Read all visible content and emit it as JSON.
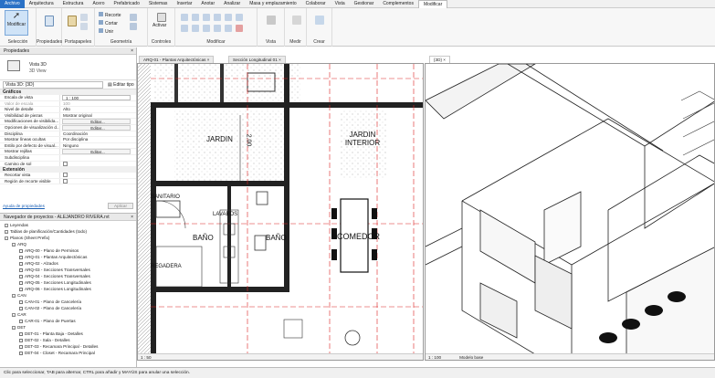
{
  "ribbon_tabs": [
    "Archivo",
    "Arquitectura",
    "Estructura",
    "Acero",
    "Prefabricado",
    "Sistemas",
    "Insertar",
    "Anotar",
    "Analizar",
    "Masa y emplazamiento",
    "Colaborar",
    "Vista",
    "Gestionar",
    "Complementos",
    "Modificar"
  ],
  "ribbon": {
    "modify_label": "Modificar",
    "select_label": "Selección",
    "properties_label": "Propiedades",
    "clipboard_label": "Portapapeles",
    "geometry_label": "Geometría",
    "geometry_items": [
      "Recorte",
      "Cortar",
      "Unir"
    ],
    "activate_label": "Activar",
    "controls_label": "Controles",
    "modify_group_label": "Modificar",
    "view_label": "Vista",
    "measure_label": "Medir",
    "create_label": "Crear"
  },
  "properties": {
    "title": "Propiedades",
    "type_name": "Vista 3D",
    "type_sub": "3D View",
    "selector": "Vista 3D: {3D}",
    "edit_type": "Editar tipo",
    "category": "Gráficos",
    "rows": [
      {
        "k": "Escala de vista",
        "v": "1 : 100",
        "kind": "input"
      },
      {
        "k": "Valor de escala",
        "v": "100",
        "kind": "grey"
      },
      {
        "k": "Nivel de detalle",
        "v": "Alto",
        "kind": "text"
      },
      {
        "k": "Visibilidad de piezas",
        "v": "Mostrar original",
        "kind": "text"
      },
      {
        "k": "Modificaciones de visibilida...",
        "v": "Editar...",
        "kind": "button"
      },
      {
        "k": "Opciones de visualización d...",
        "v": "Editar...",
        "kind": "button"
      },
      {
        "k": "Disciplina",
        "v": "Coordinación",
        "kind": "text"
      },
      {
        "k": "Mostrar líneas ocultas",
        "v": "Por disciplina",
        "kind": "text"
      },
      {
        "k": "Estilo por defecto de visual...",
        "v": "Ninguno",
        "kind": "text"
      },
      {
        "k": "Mostrar rejillas",
        "v": "Editar...",
        "kind": "button"
      },
      {
        "k": "Subdisciplina",
        "v": "",
        "kind": "text"
      },
      {
        "k": "Camino de sol",
        "v": "",
        "kind": "checkbox"
      }
    ],
    "category2": "Extensión",
    "rows2": [
      {
        "k": "Recortar vista",
        "v": "",
        "kind": "checkbox"
      },
      {
        "k": "Región de recorte visible",
        "v": "",
        "kind": "checkbox"
      }
    ],
    "help_link": "Ayuda de propiedades",
    "apply": "Aplicar"
  },
  "browser": {
    "title": "Navegador de proyectos - ALEJANDRO RIVERA.rvt",
    "items": [
      {
        "label": "Leyendas",
        "level": 0,
        "type": "node"
      },
      {
        "label": "Tablas de planificación/Cantidades (todo)",
        "level": 0,
        "type": "node"
      },
      {
        "label": "Planos (Sheet Prefix)",
        "level": 0,
        "type": "node"
      },
      {
        "label": "ARQ",
        "level": 1,
        "type": "node"
      },
      {
        "label": "ARQ-00 - Plano de Permisos",
        "level": 2,
        "type": "sheet"
      },
      {
        "label": "ARQ-01 - Plantas Arquitectónicas",
        "level": 2,
        "type": "sheet"
      },
      {
        "label": "ARQ-02 - Alzados",
        "level": 2,
        "type": "sheet"
      },
      {
        "label": "ARQ-03 - Secciones Transversales",
        "level": 2,
        "type": "sheet"
      },
      {
        "label": "ARQ-04 - Secciones Transversales",
        "level": 2,
        "type": "sheet"
      },
      {
        "label": "ARQ-05 - Secciones Longitudinales",
        "level": 2,
        "type": "sheet"
      },
      {
        "label": "ARQ-06 - Secciones Longitudinales",
        "level": 2,
        "type": "sheet"
      },
      {
        "label": "CAN",
        "level": 1,
        "type": "node"
      },
      {
        "label": "CAN-01 - Plano de Cancelería",
        "level": 2,
        "type": "sheet"
      },
      {
        "label": "CAN-02 - Plano de Cancelería",
        "level": 2,
        "type": "sheet"
      },
      {
        "label": "CAR",
        "level": 1,
        "type": "node"
      },
      {
        "label": "CAR-01 - Plano de Puertas",
        "level": 2,
        "type": "sheet"
      },
      {
        "label": "DET",
        "level": 1,
        "type": "node"
      },
      {
        "label": "DET-01 - Planta Baja - Detalles",
        "level": 2,
        "type": "sheet"
      },
      {
        "label": "DET-02 - Sala - Detalles",
        "level": 2,
        "type": "sheet"
      },
      {
        "label": "DET-03 - Recamara Principal - Detalles",
        "level": 2,
        "type": "sheet"
      },
      {
        "label": "DET-04 - Closet - Recamara Principal",
        "level": 2,
        "type": "sheet"
      }
    ]
  },
  "view_tabs": [
    {
      "label": "ARQ-01 - Plantas Arquitectónicas",
      "active": false
    },
    {
      "label": "Sección Longitudinal 01",
      "active": false
    },
    {
      "label": "{3D}",
      "active": true
    }
  ],
  "plan": {
    "rooms": [
      "JARDIN",
      "JARDIN INTERIOR",
      "SANITARIO",
      "LAVABOS",
      "BAÑO",
      "BAÑO",
      "COMEDOR",
      "REGADERA"
    ],
    "dimension": "2.00",
    "scale": "1 : 50"
  },
  "view3d": {
    "scale": "1 : 100",
    "model": "Modelo base"
  },
  "status": "Clic para seleccionar, TAB para alternar, CTRL para añadir y MAYÚS para anular una selección."
}
